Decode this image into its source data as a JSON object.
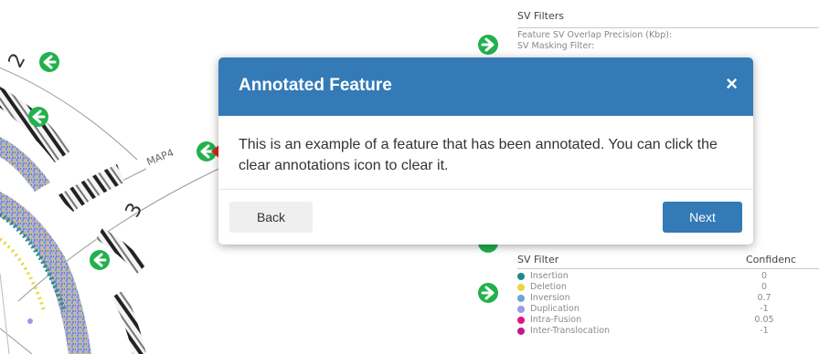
{
  "circos": {
    "chromosome_labels": [
      "2",
      "3"
    ],
    "gene_label": "MAP4"
  },
  "sv_filters_panel": {
    "title": "SV Filters",
    "precision_label": "Feature SV Overlap Precision (Kbp):",
    "masking_label": "SV Masking Filter:"
  },
  "sv_filter_table": {
    "column_header": "SV Filter",
    "confidence_header": "Confidenc",
    "rows": [
      {
        "label": "Insertion",
        "value": "0",
        "color": "#1e8a8a"
      },
      {
        "label": "Deletion",
        "value": "0",
        "color": "#e6d83a"
      },
      {
        "label": "Inversion",
        "value": "0.7",
        "color": "#6fa3d6"
      },
      {
        "label": "Duplication",
        "value": "-1",
        "color": "#9a9ae6"
      },
      {
        "label": "Intra-Fusion",
        "value": "0.05",
        "color": "#e0157d"
      },
      {
        "label": "Inter-Translocation",
        "value": "-1",
        "color": "#c2188a"
      }
    ]
  },
  "modal": {
    "title": "Annotated Feature",
    "close_symbol": "×",
    "body": "This is an example of a feature that has been annotated. You can click the clear annotations icon to clear it.",
    "back_label": "Back",
    "next_label": "Next"
  },
  "colors": {
    "modal_header": "#337ab7",
    "nav_icon_green": "#22b14c",
    "annotation_marker": "#e02020"
  },
  "icons": [
    "arrow-left-circle-icon",
    "arrow-right-circle-icon",
    "annotation-marker-icon"
  ]
}
